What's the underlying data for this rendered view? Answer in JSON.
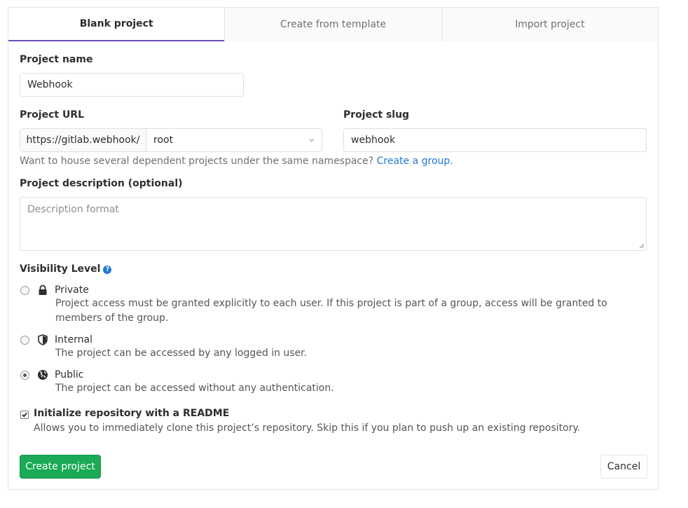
{
  "tabs": [
    {
      "label": "Blank project",
      "active": true
    },
    {
      "label": "Create from template",
      "active": false
    },
    {
      "label": "Import project",
      "active": false
    }
  ],
  "project_name": {
    "label": "Project name",
    "value": "Webhook"
  },
  "project_url": {
    "label": "Project URL",
    "prefix": "https://gitlab.webhook/",
    "namespace": "root"
  },
  "project_slug": {
    "label": "Project slug",
    "value": "webhook"
  },
  "namespace_help": {
    "text": "Want to house several dependent projects under the same namespace?",
    "link": "Create a group."
  },
  "description": {
    "label": "Project description (optional)",
    "placeholder": "Description format"
  },
  "visibility": {
    "label": "Visibility Level",
    "help_icon": "?",
    "selected": "Public",
    "options": [
      {
        "title": "Private",
        "icon": "lock-icon",
        "desc": "Project access must be granted explicitly to each user. If this project is part of a group, access will be granted to members of the group."
      },
      {
        "title": "Internal",
        "icon": "shield-icon",
        "desc": "The project can be accessed by any logged in user."
      },
      {
        "title": "Public",
        "icon": "globe-icon",
        "desc": "The project can be accessed without any authentication."
      }
    ]
  },
  "readme": {
    "checked": true,
    "label": "Initialize repository with a README",
    "desc": "Allows you to immediately clone this project’s repository. Skip this if you plan to push up an existing repository."
  },
  "actions": {
    "create": "Create project",
    "cancel": "Cancel"
  },
  "colors": {
    "accent": "#6b4fbb",
    "primary": "#1aaa55",
    "link": "#1f78d1"
  }
}
